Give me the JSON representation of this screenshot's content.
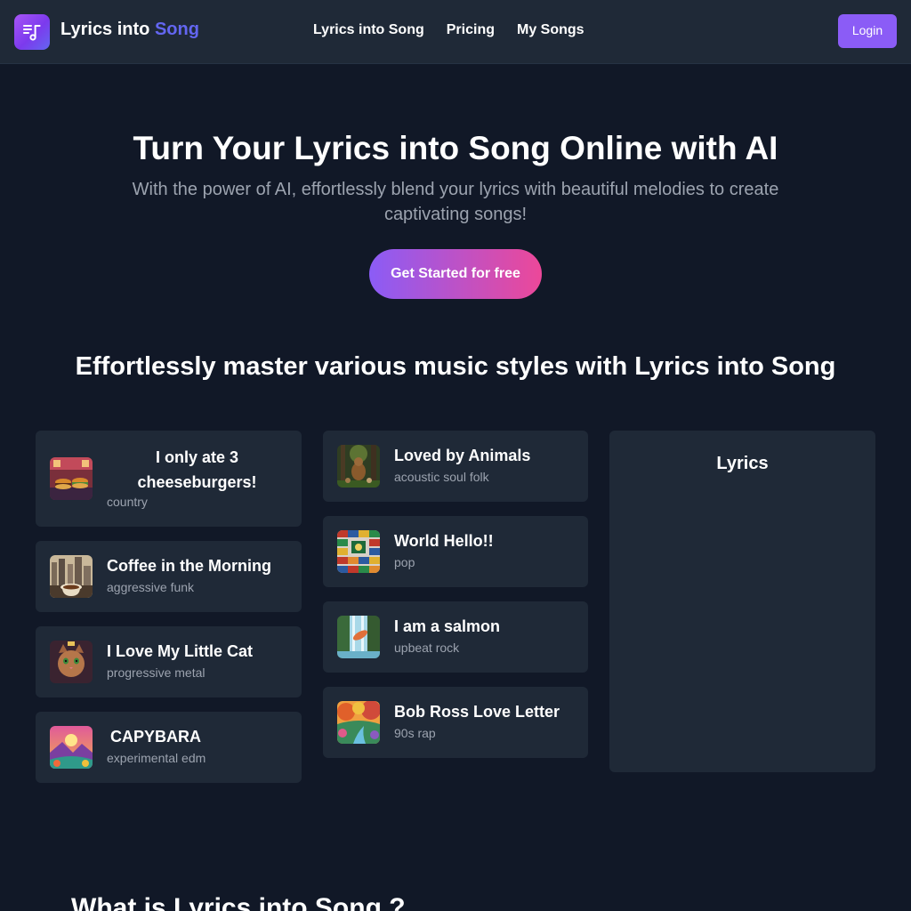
{
  "header": {
    "logo_icon": "playlist-music-icon",
    "brand_part1": "Lyrics into",
    "brand_part2": "Song",
    "nav": [
      "Lyrics into Song",
      "Pricing",
      "My Songs"
    ],
    "login_label": "Login"
  },
  "hero": {
    "title": "Turn Your Lyrics into Song Online with AI",
    "subtitle": "With the power of AI, effortlessly blend your lyrics with beautiful melodies to create captivating songs!",
    "cta_label": "Get Started for free"
  },
  "styles": {
    "title": "Effortlessly master various music styles with Lyrics into Song",
    "col1": [
      {
        "title": "I only ate 3 cheeseburgers!",
        "genre": "country",
        "thumb": "cheeseburger-diner-artwork"
      },
      {
        "title": "Coffee in the Morning",
        "genre": "aggressive funk",
        "thumb": "coffee-city-artwork"
      },
      {
        "title": "I Love My Little Cat",
        "genre": "progressive metal",
        "thumb": "cat-portrait-artwork"
      },
      {
        "title": "CAPYBARA",
        "genre": "experimental edm",
        "thumb": "colorful-landscape-artwork"
      }
    ],
    "col2": [
      {
        "title": "Loved by Animals",
        "genre": "acoustic soul folk",
        "thumb": "forest-animals-artwork"
      },
      {
        "title": "World Hello!!",
        "genre": "pop",
        "thumb": "world-flags-artwork"
      },
      {
        "title": "I am a salmon",
        "genre": "upbeat rock",
        "thumb": "waterfall-salmon-artwork"
      },
      {
        "title": "Bob Ross Love Letter",
        "genre": "90s rap",
        "thumb": "autumn-river-artwork"
      }
    ],
    "lyrics_heading": "Lyrics"
  },
  "about": {
    "title": "What is Lyrics into Song ?"
  },
  "colors": {
    "background": "#111827",
    "surface": "#1f2937",
    "accent": "#8b5cf6",
    "brand_accent": "#6366f1",
    "gradient_end": "#ec4899",
    "muted_text": "#9ca3af"
  }
}
